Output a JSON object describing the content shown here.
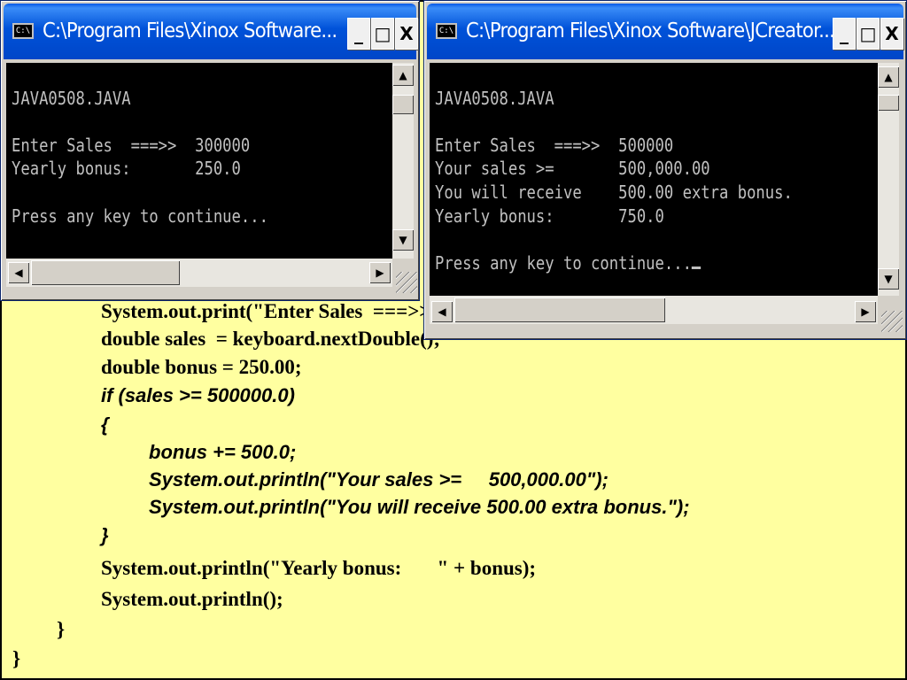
{
  "code": {
    "lines": [
      "System.out.print(\"Enter Sales  ===>>  \");",
      "double sales  = keyboard.nextDouble();",
      "double bonus = 250.00;",
      "if (sales >= 500000.0)",
      "{",
      "bonus += 500.0;",
      "System.out.println(\"Your sales >=     500,000.00\");",
      "System.out.println(\"You will receive 500.00 extra bonus.\");",
      "}",
      "System.out.println(\"Yearly bonus:       \" + bonus);",
      "System.out.println();",
      "}",
      "}"
    ]
  },
  "windows": [
    {
      "title": "C:\\Program Files\\Xinox Software...",
      "icon_label": "C:\\",
      "buttons": [
        "_",
        "□",
        "X"
      ],
      "output": [
        "",
        "JAVA0508.JAVA",
        "",
        "Enter Sales  ===>>  300000",
        "Yearly bonus:       250.0",
        "",
        "Press any key to continue..."
      ]
    },
    {
      "title": "C:\\Program Files\\Xinox Software\\JCreator...",
      "icon_label": "C:\\",
      "buttons": [
        "_",
        "□",
        "X"
      ],
      "output": [
        "",
        "JAVA0508.JAVA",
        "",
        "Enter Sales  ===>>  500000",
        "Your sales >=       500,000.00",
        "You will receive    500.00 extra bonus.",
        "Yearly bonus:       750.0",
        "",
        "Press any key to continue..."
      ]
    }
  ],
  "scroll_icons": {
    "up": "▲",
    "down": "▼",
    "left": "◀",
    "right": "▶"
  },
  "colors": {
    "slide_bg": "#ffffa0",
    "titlebar": "#0052d9",
    "console_bg": "#000000",
    "console_text": "#c0c0c0"
  }
}
